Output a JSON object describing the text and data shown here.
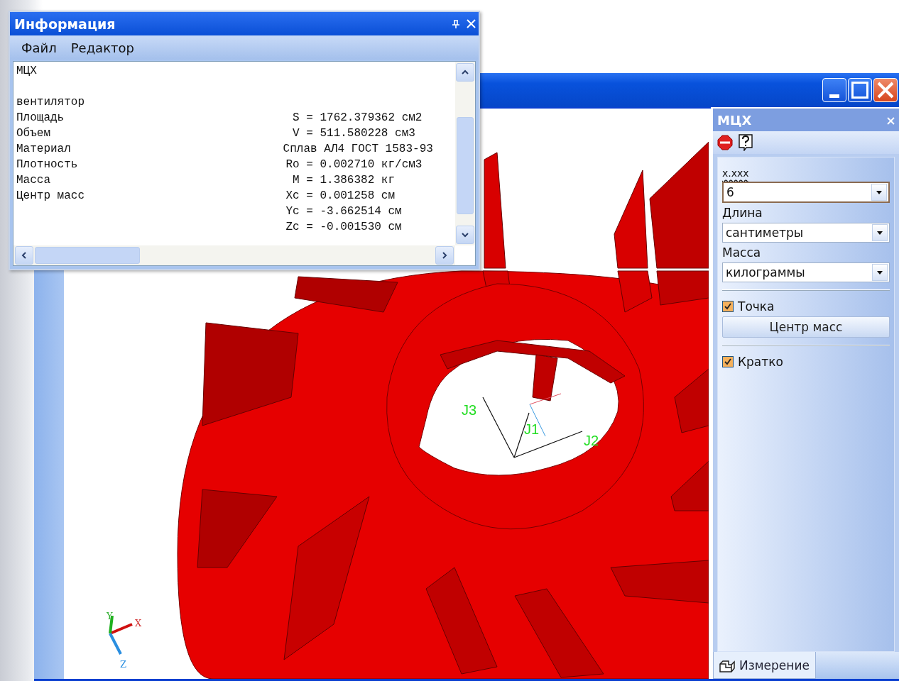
{
  "info_window": {
    "title": "Информация",
    "menu": [
      {
        "label": "Файл"
      },
      {
        "label": "Редактор"
      }
    ],
    "heading": "МЦХ",
    "object": "вентилятор",
    "rows": [
      {
        "label": "Площадь",
        "symbol": "S",
        "value": "= 1762.379362 см2"
      },
      {
        "label": "Объем",
        "symbol": "V",
        "value": "= 511.580228 см3"
      },
      {
        "label": "Материал",
        "value": "Сплав АЛ4 ГОСТ 1583-93"
      },
      {
        "label": "Плотность",
        "symbol": "Ro",
        "value": "= 0.002710 кг/см3"
      },
      {
        "label": "Масса",
        "symbol": "M",
        "value": "= 1.386382 кг"
      },
      {
        "label": "Центр масс",
        "symbol": "Xc",
        "value": "= 0.001258 см"
      },
      {
        "symbol": "Yc",
        "value": "= -3.662514 см"
      },
      {
        "symbol": "Zc",
        "value": "= -0.001530 см"
      }
    ]
  },
  "viewport": {
    "vectors": [
      "J3",
      "J1",
      "J2"
    ],
    "axes": [
      "X",
      "Y",
      "Z"
    ]
  },
  "panel": {
    "title": "МЦХ",
    "precision_label": "x.xxx",
    "precision": "6",
    "fields": [
      {
        "label": "Длина",
        "value": "сантиметры"
      },
      {
        "label": "Масса",
        "value": "килограммы"
      }
    ],
    "point": {
      "label": "Точка",
      "checked": true
    },
    "button": "Центр масс",
    "brief": {
      "label": "Кратко",
      "checked": true
    },
    "tabs": [
      {
        "label": "Измерение",
        "selected": true
      }
    ]
  }
}
